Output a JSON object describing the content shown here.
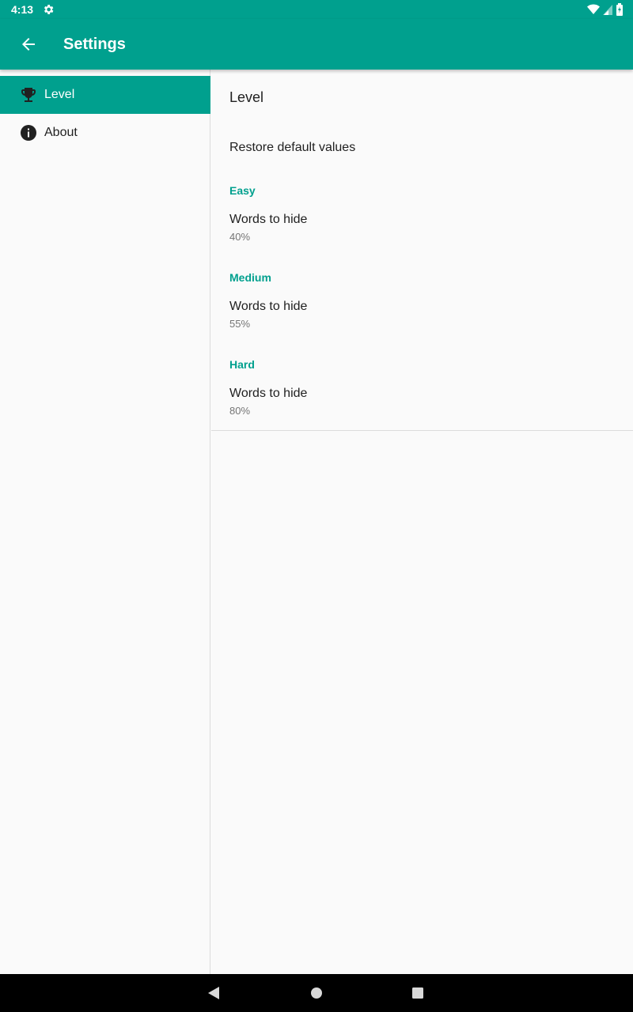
{
  "status_bar": {
    "time": "4:13",
    "icons": [
      "settings-gear-icon",
      "wifi-icon",
      "signal-icon",
      "battery-icon"
    ]
  },
  "app_bar": {
    "title": "Settings",
    "back_icon": "arrow-back-icon"
  },
  "sidebar": {
    "items": [
      {
        "label": "Level",
        "icon": "trophy-icon",
        "active": true
      },
      {
        "label": "About",
        "icon": "info-icon",
        "active": false
      }
    ]
  },
  "content": {
    "header": "Level",
    "restore_label": "Restore default values",
    "categories": [
      {
        "name": "Easy",
        "pref_title": "Words to hide",
        "pref_value": "40%"
      },
      {
        "name": "Medium",
        "pref_title": "Words to hide",
        "pref_value": "55%"
      },
      {
        "name": "Hard",
        "pref_title": "Words to hide",
        "pref_value": "80%"
      }
    ]
  },
  "nav_bar": {
    "icons": [
      "back-triangle-icon",
      "home-circle-icon",
      "recents-square-icon"
    ]
  },
  "colors": {
    "primary": "#00a08e",
    "text_primary": "#212121",
    "text_secondary": "#757575",
    "background": "#fafafa"
  }
}
